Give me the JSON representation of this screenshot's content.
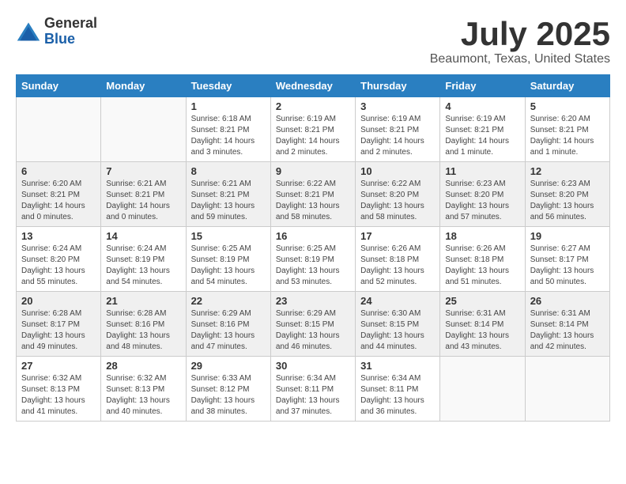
{
  "logo": {
    "general": "General",
    "blue": "Blue"
  },
  "title": "July 2025",
  "location": "Beaumont, Texas, United States",
  "weekdays": [
    "Sunday",
    "Monday",
    "Tuesday",
    "Wednesday",
    "Thursday",
    "Friday",
    "Saturday"
  ],
  "weeks": [
    [
      {
        "day": "",
        "info": ""
      },
      {
        "day": "",
        "info": ""
      },
      {
        "day": "1",
        "info": "Sunrise: 6:18 AM\nSunset: 8:21 PM\nDaylight: 14 hours and 3 minutes."
      },
      {
        "day": "2",
        "info": "Sunrise: 6:19 AM\nSunset: 8:21 PM\nDaylight: 14 hours and 2 minutes."
      },
      {
        "day": "3",
        "info": "Sunrise: 6:19 AM\nSunset: 8:21 PM\nDaylight: 14 hours and 2 minutes."
      },
      {
        "day": "4",
        "info": "Sunrise: 6:19 AM\nSunset: 8:21 PM\nDaylight: 14 hours and 1 minute."
      },
      {
        "day": "5",
        "info": "Sunrise: 6:20 AM\nSunset: 8:21 PM\nDaylight: 14 hours and 1 minute."
      }
    ],
    [
      {
        "day": "6",
        "info": "Sunrise: 6:20 AM\nSunset: 8:21 PM\nDaylight: 14 hours and 0 minutes."
      },
      {
        "day": "7",
        "info": "Sunrise: 6:21 AM\nSunset: 8:21 PM\nDaylight: 14 hours and 0 minutes."
      },
      {
        "day": "8",
        "info": "Sunrise: 6:21 AM\nSunset: 8:21 PM\nDaylight: 13 hours and 59 minutes."
      },
      {
        "day": "9",
        "info": "Sunrise: 6:22 AM\nSunset: 8:21 PM\nDaylight: 13 hours and 58 minutes."
      },
      {
        "day": "10",
        "info": "Sunrise: 6:22 AM\nSunset: 8:20 PM\nDaylight: 13 hours and 58 minutes."
      },
      {
        "day": "11",
        "info": "Sunrise: 6:23 AM\nSunset: 8:20 PM\nDaylight: 13 hours and 57 minutes."
      },
      {
        "day": "12",
        "info": "Sunrise: 6:23 AM\nSunset: 8:20 PM\nDaylight: 13 hours and 56 minutes."
      }
    ],
    [
      {
        "day": "13",
        "info": "Sunrise: 6:24 AM\nSunset: 8:20 PM\nDaylight: 13 hours and 55 minutes."
      },
      {
        "day": "14",
        "info": "Sunrise: 6:24 AM\nSunset: 8:19 PM\nDaylight: 13 hours and 54 minutes."
      },
      {
        "day": "15",
        "info": "Sunrise: 6:25 AM\nSunset: 8:19 PM\nDaylight: 13 hours and 54 minutes."
      },
      {
        "day": "16",
        "info": "Sunrise: 6:25 AM\nSunset: 8:19 PM\nDaylight: 13 hours and 53 minutes."
      },
      {
        "day": "17",
        "info": "Sunrise: 6:26 AM\nSunset: 8:18 PM\nDaylight: 13 hours and 52 minutes."
      },
      {
        "day": "18",
        "info": "Sunrise: 6:26 AM\nSunset: 8:18 PM\nDaylight: 13 hours and 51 minutes."
      },
      {
        "day": "19",
        "info": "Sunrise: 6:27 AM\nSunset: 8:17 PM\nDaylight: 13 hours and 50 minutes."
      }
    ],
    [
      {
        "day": "20",
        "info": "Sunrise: 6:28 AM\nSunset: 8:17 PM\nDaylight: 13 hours and 49 minutes."
      },
      {
        "day": "21",
        "info": "Sunrise: 6:28 AM\nSunset: 8:16 PM\nDaylight: 13 hours and 48 minutes."
      },
      {
        "day": "22",
        "info": "Sunrise: 6:29 AM\nSunset: 8:16 PM\nDaylight: 13 hours and 47 minutes."
      },
      {
        "day": "23",
        "info": "Sunrise: 6:29 AM\nSunset: 8:15 PM\nDaylight: 13 hours and 46 minutes."
      },
      {
        "day": "24",
        "info": "Sunrise: 6:30 AM\nSunset: 8:15 PM\nDaylight: 13 hours and 44 minutes."
      },
      {
        "day": "25",
        "info": "Sunrise: 6:31 AM\nSunset: 8:14 PM\nDaylight: 13 hours and 43 minutes."
      },
      {
        "day": "26",
        "info": "Sunrise: 6:31 AM\nSunset: 8:14 PM\nDaylight: 13 hours and 42 minutes."
      }
    ],
    [
      {
        "day": "27",
        "info": "Sunrise: 6:32 AM\nSunset: 8:13 PM\nDaylight: 13 hours and 41 minutes."
      },
      {
        "day": "28",
        "info": "Sunrise: 6:32 AM\nSunset: 8:13 PM\nDaylight: 13 hours and 40 minutes."
      },
      {
        "day": "29",
        "info": "Sunrise: 6:33 AM\nSunset: 8:12 PM\nDaylight: 13 hours and 38 minutes."
      },
      {
        "day": "30",
        "info": "Sunrise: 6:34 AM\nSunset: 8:11 PM\nDaylight: 13 hours and 37 minutes."
      },
      {
        "day": "31",
        "info": "Sunrise: 6:34 AM\nSunset: 8:11 PM\nDaylight: 13 hours and 36 minutes."
      },
      {
        "day": "",
        "info": ""
      },
      {
        "day": "",
        "info": ""
      }
    ]
  ]
}
